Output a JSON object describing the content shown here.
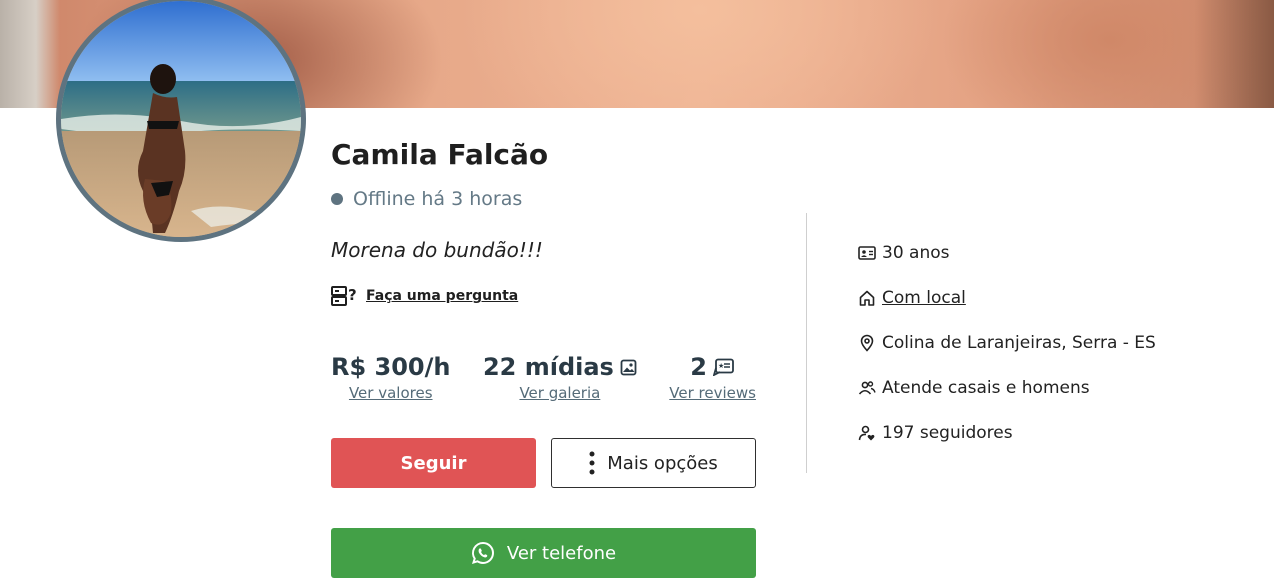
{
  "profile": {
    "name": "Camila Falcão",
    "status": "Offline há 3 horas",
    "bio": "Morena do bundão!!!",
    "ask_label": "Faça uma pergunta"
  },
  "stats": [
    {
      "value": "R$ 300/h",
      "link": "Ver valores",
      "icon": ""
    },
    {
      "value": "22 mídias",
      "link": "Ver galeria",
      "icon": "image-icon"
    },
    {
      "value": "2",
      "link": "Ver reviews",
      "icon": "review-icon"
    }
  ],
  "buttons": {
    "follow": "Seguir",
    "more": "Mais opções",
    "phone": "Ver telefone"
  },
  "info": {
    "age": "30 anos",
    "location_type": "Com local",
    "address": "Colina de Laranjeiras, Serra - ES",
    "serves": "Atende casais e homens",
    "followers": "197 seguidores"
  },
  "colors": {
    "follow_button": "#e05455",
    "phone_button": "#43a047",
    "status_dot": "#5e7380",
    "avatar_border": "#5e7380"
  }
}
